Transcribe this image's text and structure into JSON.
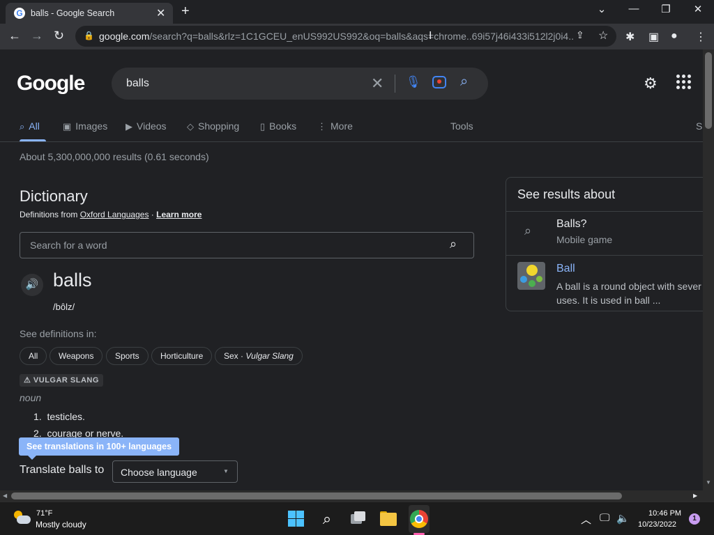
{
  "browser": {
    "tab_title": "balls - Google Search",
    "tab_favicon": "G",
    "new_tab": "+",
    "url_host": "google.com",
    "url_path": "/search?q=balls&rlz=1C1GCEU_enUS992US992&oq=balls&aqs=chrome..69i57j46i433i512l2j0i4..."
  },
  "search": {
    "logo": "Google",
    "query": "balls"
  },
  "nav_tabs": {
    "all": "All",
    "images": "Images",
    "videos": "Videos",
    "shopping": "Shopping",
    "books": "Books",
    "more": "More",
    "tools": "Tools",
    "safe": "S"
  },
  "result_stats": "About 5,300,000,000 results (0.61 seconds)",
  "dictionary": {
    "title": "Dictionary",
    "source_prefix": "Definitions from ",
    "source_link": "Oxford Languages",
    "separator": " · ",
    "learn_more": "Learn more",
    "search_placeholder": "Search for a word",
    "headword": "balls",
    "phonetic": "/bôlz/",
    "see_definitions": "See definitions in:",
    "chips": {
      "all": "All",
      "weapons": "Weapons",
      "sports": "Sports",
      "horticulture": "Horticulture",
      "sex": "Sex",
      "sex_qualifier": "Vulgar Slang"
    },
    "label": "⚠ VULGAR SLANG",
    "part_of_speech": "noun",
    "definitions": [
      {
        "num": "1.",
        "text": "testicles."
      },
      {
        "num": "2.",
        "text": "courage or nerve."
      }
    ],
    "tooltip": "See translations in 100+ languages",
    "translate_label": "Translate balls to",
    "language_select": "Choose language"
  },
  "side_panel": {
    "title": "See results about",
    "results": [
      {
        "title": "Balls?",
        "subtitle": "Mobile game"
      },
      {
        "title": "Ball",
        "line1": "A ball is a round object with sever",
        "line2": "uses. It is used in ball ..."
      }
    ]
  },
  "taskbar": {
    "weather_temp": "71°F",
    "weather_desc": "Mostly cloudy",
    "time": "10:46 PM",
    "date": "10/23/2022",
    "notifications": "1"
  },
  "colors": {
    "background": "#202124",
    "link": "#8ab4f8",
    "accent": "#4285f4"
  }
}
